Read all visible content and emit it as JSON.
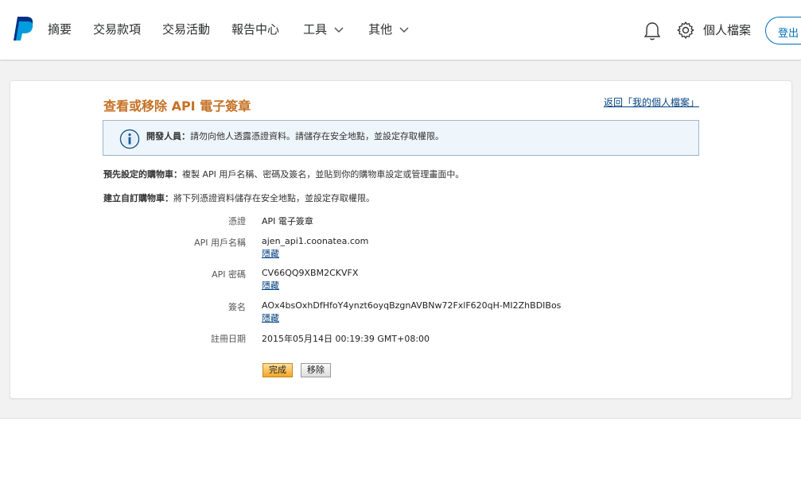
{
  "nav": {
    "items": [
      {
        "label": "摘要"
      },
      {
        "label": "交易款項"
      },
      {
        "label": "交易活動"
      },
      {
        "label": "報告中心"
      },
      {
        "label": "工具"
      },
      {
        "label": "其他"
      }
    ],
    "profile_label": "個人檔案",
    "logout_label": "登出"
  },
  "page": {
    "title": "查看或移除 API 電子簽章",
    "back_link": "返回「我的個人檔案」"
  },
  "notice": {
    "bold": "開發人員：",
    "text": "請勿向他人透露憑證資料。請儲存在安全地點，並設定存取權限。"
  },
  "paragraphs": {
    "preset_bold": "預先設定的購物車：",
    "preset_text": "複製 API 用戶名稱、密碼及簽名，並貼到你的購物車設定或管理畫面中。",
    "custom_bold": "建立自訂購物車：",
    "custom_text": "將下列憑證資料儲存在安全地點，並設定存取權限。"
  },
  "fields": {
    "credential_label": "憑證",
    "credential_value": "API 電子簽章",
    "username_label": "API 用戶名稱",
    "username_value": "ajen_api1.coonatea.com",
    "password_label": "API 密碼",
    "password_value": "CV66QQ9XBM2CKVFX",
    "signature_label": "簽名",
    "signature_value": "AOx4bsOxhDfHfoY4ynzt6oyqBzgnAVBNw72FxlF620qH-MI2ZhBDIBos",
    "date_label": "註冊日期",
    "date_value": "2015年05月14日 00:19:39 GMT+08:00",
    "hide_label": "隱藏"
  },
  "buttons": {
    "done": "完成",
    "remove": "移除"
  },
  "colors": {
    "brand_blue": "#0070ba",
    "title_orange": "#c67124",
    "link_blue": "#084482"
  }
}
